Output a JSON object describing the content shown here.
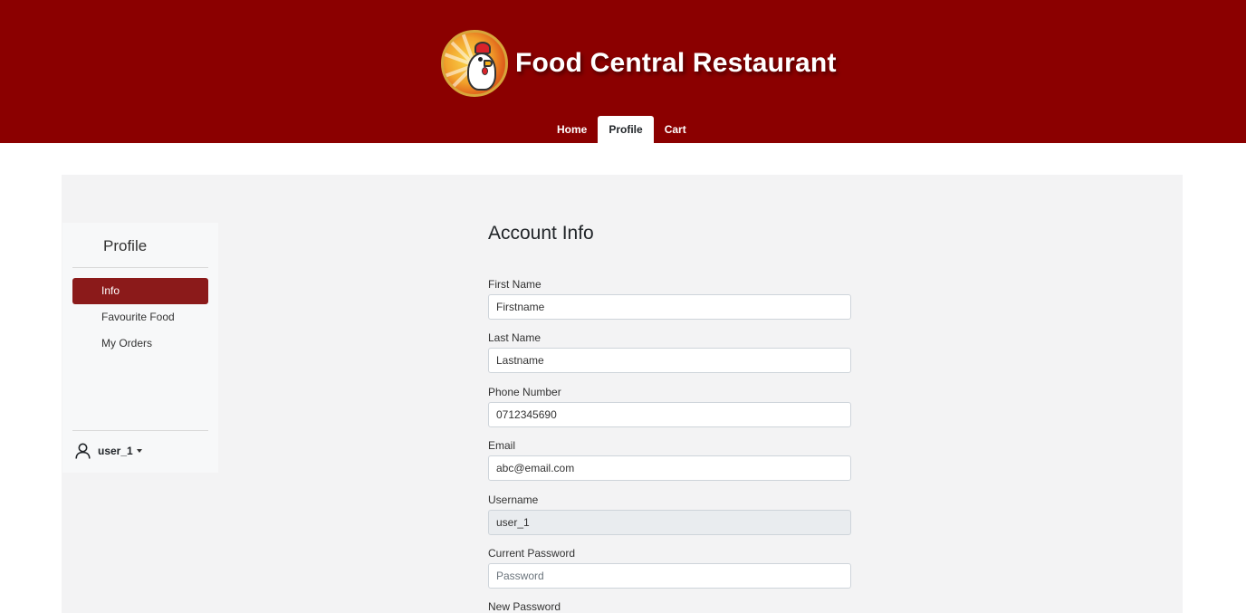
{
  "header": {
    "title": "Food Central Restaurant",
    "logo_icon": "chicken-mascot-logo",
    "brand_color": "#8b0000"
  },
  "nav": {
    "tabs": [
      {
        "label": "Home",
        "active": false
      },
      {
        "label": "Profile",
        "active": true
      },
      {
        "label": "Cart",
        "active": false
      }
    ]
  },
  "sidebar": {
    "title": "Profile",
    "items": [
      {
        "label": "Info",
        "active": true
      },
      {
        "label": "Favourite Food",
        "active": false
      },
      {
        "label": "My Orders",
        "active": false
      }
    ],
    "user": {
      "name": "user_1",
      "icon": "user-icon"
    }
  },
  "form": {
    "heading": "Account Info",
    "fields": [
      {
        "label": "First Name",
        "value": "Firstname",
        "placeholder": ""
      },
      {
        "label": "Last Name",
        "value": "Lastname",
        "placeholder": ""
      },
      {
        "label": "Phone Number",
        "value": "0712345690",
        "placeholder": ""
      },
      {
        "label": "Email",
        "value": "abc@email.com",
        "placeholder": ""
      },
      {
        "label": "Username",
        "value": "user_1",
        "placeholder": "",
        "disabled": true
      },
      {
        "label": "Current Password",
        "value": "",
        "placeholder": "Password"
      },
      {
        "label": "New Password"
      }
    ]
  },
  "colors": {
    "accent": "#8b1a1a",
    "panel_bg": "#f3f3f4",
    "disabled_input_bg": "#e9ecef"
  }
}
